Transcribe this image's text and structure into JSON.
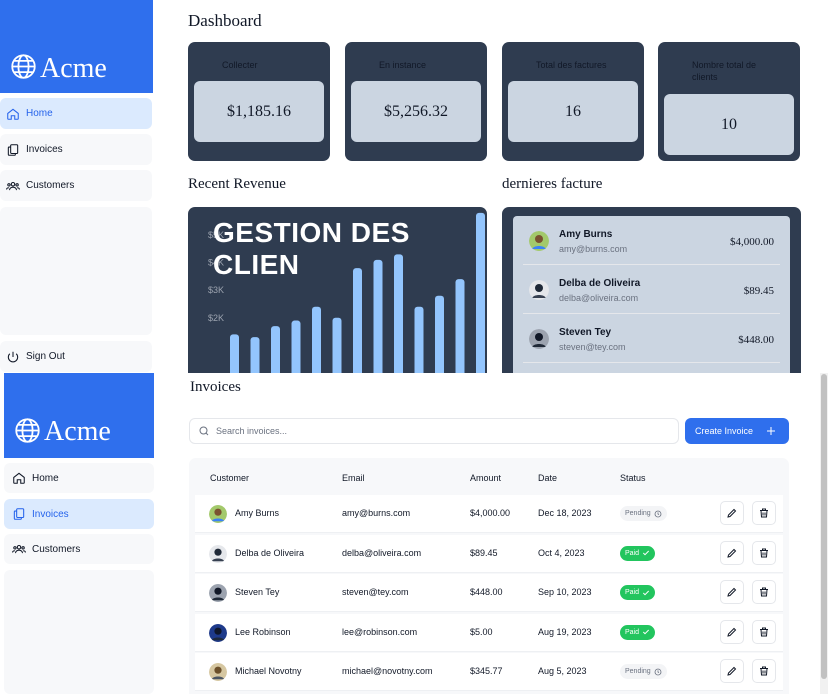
{
  "brand": {
    "name": "Acme",
    "color": "#2f6fed"
  },
  "top_sidebar": {
    "items": [
      {
        "label": "Home",
        "icon": "home-icon",
        "active": true
      },
      {
        "label": "Invoices",
        "icon": "document-duplicate-icon",
        "active": false
      },
      {
        "label": "Customers",
        "icon": "user-group-icon",
        "active": false
      }
    ],
    "sign_out": "Sign Out"
  },
  "dashboard": {
    "title": "Dashboard",
    "cards": [
      {
        "label": "Collecter",
        "value": "$1,185.16"
      },
      {
        "label": "En instance",
        "value": "$5,256.32"
      },
      {
        "label": "Total des factures",
        "value": "16"
      },
      {
        "label": "Nombre total de clients",
        "value": "10"
      }
    ],
    "recent_revenue_title": "Recent Revenue",
    "overlay_text": "GESTION DES CLIEN",
    "latest_title": "dernieres facture",
    "latest": [
      {
        "name": "Amy Burns",
        "email": "amy@burns.com",
        "amount": "$4,000.00"
      },
      {
        "name": "Delba de Oliveira",
        "email": "delba@oliveira.com",
        "amount": "$89.45"
      },
      {
        "name": "Steven Tey",
        "email": "steven@tey.com",
        "amount": "$448.00"
      }
    ]
  },
  "chart_data": {
    "type": "bar",
    "title": "",
    "xlabel": "",
    "ylabel": "",
    "y_tick_labels": [
      "$5K",
      "$4K",
      "$3K",
      "$2K"
    ],
    "ylim": [
      0,
      5000
    ],
    "values": [
      1400,
      1300,
      1700,
      1900,
      2400,
      2000,
      3800,
      4100,
      4300,
      2400,
      2800,
      3400,
      5800
    ],
    "bar_color": "#93c5fd"
  },
  "bottom_sidebar": {
    "items": [
      {
        "label": "Home",
        "icon": "home-icon",
        "active": false
      },
      {
        "label": "Invoices",
        "icon": "document-duplicate-icon",
        "active": true
      },
      {
        "label": "Customers",
        "icon": "user-group-icon",
        "active": false
      }
    ]
  },
  "invoices": {
    "title": "Invoices",
    "search_placeholder": "Search invoices...",
    "create_label": "Create Invoice",
    "columns": [
      "Customer",
      "Email",
      "Amount",
      "Date",
      "Status"
    ],
    "rows": [
      {
        "customer": "Amy Burns",
        "email": "amy@burns.com",
        "amount": "$4,000.00",
        "date": "Dec 18, 2023",
        "status": "Pending"
      },
      {
        "customer": "Delba de Oliveira",
        "email": "delba@oliveira.com",
        "amount": "$89.45",
        "date": "Oct 4, 2023",
        "status": "Paid"
      },
      {
        "customer": "Steven Tey",
        "email": "steven@tey.com",
        "amount": "$448.00",
        "date": "Sep 10, 2023",
        "status": "Paid"
      },
      {
        "customer": "Lee Robinson",
        "email": "lee@robinson.com",
        "amount": "$5.00",
        "date": "Aug 19, 2023",
        "status": "Paid"
      },
      {
        "customer": "Michael Novotny",
        "email": "michael@novotny.com",
        "amount": "$345.77",
        "date": "Aug 5, 2023",
        "status": "Pending"
      }
    ]
  }
}
